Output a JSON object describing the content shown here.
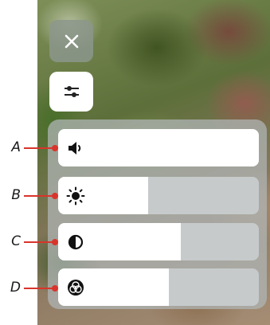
{
  "colors": {
    "accent_red": "#d9342b",
    "slider_fill": "#ffffff",
    "slider_track": "#c6cacb"
  },
  "buttons": {
    "close": {
      "icon": "close-icon"
    },
    "settings": {
      "icon": "sliders-icon"
    }
  },
  "sliders": [
    {
      "id": "volume",
      "icon": "speaker-icon",
      "level_percent": 100,
      "callout": "A"
    },
    {
      "id": "brightness",
      "icon": "sun-icon",
      "level_percent": 45,
      "callout": "B"
    },
    {
      "id": "contrast",
      "icon": "contrast-icon",
      "level_percent": 61,
      "callout": "C"
    },
    {
      "id": "color",
      "icon": "color-circles-icon",
      "level_percent": 55,
      "callout": "D"
    }
  ]
}
